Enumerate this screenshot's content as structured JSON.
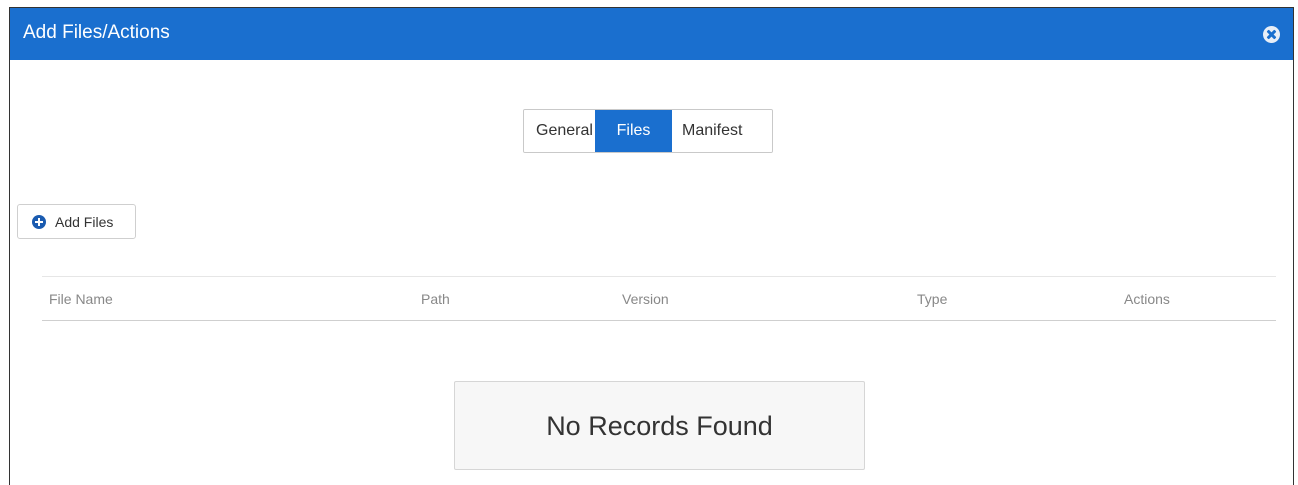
{
  "dialog": {
    "title": "Add Files/Actions",
    "accent_color": "#1a6fcf"
  },
  "tabs": [
    {
      "label": "General",
      "active": false
    },
    {
      "label": "Files",
      "active": true
    },
    {
      "label": "Manifest",
      "active": false
    }
  ],
  "toolbar": {
    "add_files_label": "Add Files",
    "add_icon": "plus-circle-icon"
  },
  "table": {
    "columns": [
      "File Name",
      "Path",
      "Version",
      "Type",
      "Actions"
    ],
    "rows": [],
    "empty_message": "No Records Found"
  }
}
